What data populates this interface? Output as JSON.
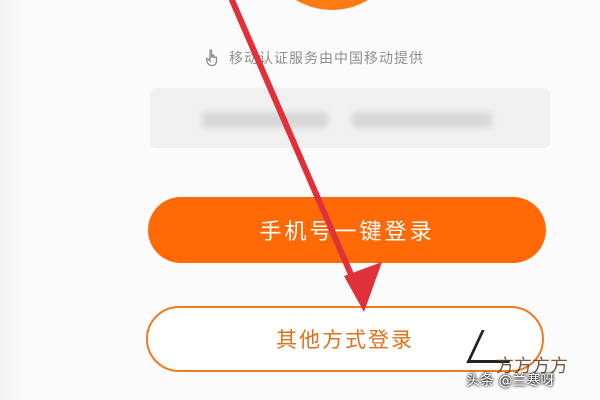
{
  "auth": {
    "notice_text": "移动认证服务由中国移动提供",
    "notice_icon": "hand-pointer-icon"
  },
  "phone_field": {
    "masked": true
  },
  "buttons": {
    "one_click_login": "手机号一键登录",
    "other_methods": "其他方式登录"
  },
  "overlay": {
    "corner_text": "方方方方",
    "watermark": "头条 @兰寒呀",
    "arrow_color": "#e0303a"
  },
  "colors": {
    "brand_orange": "#ff6a06",
    "outline_orange": "#f07a22"
  }
}
